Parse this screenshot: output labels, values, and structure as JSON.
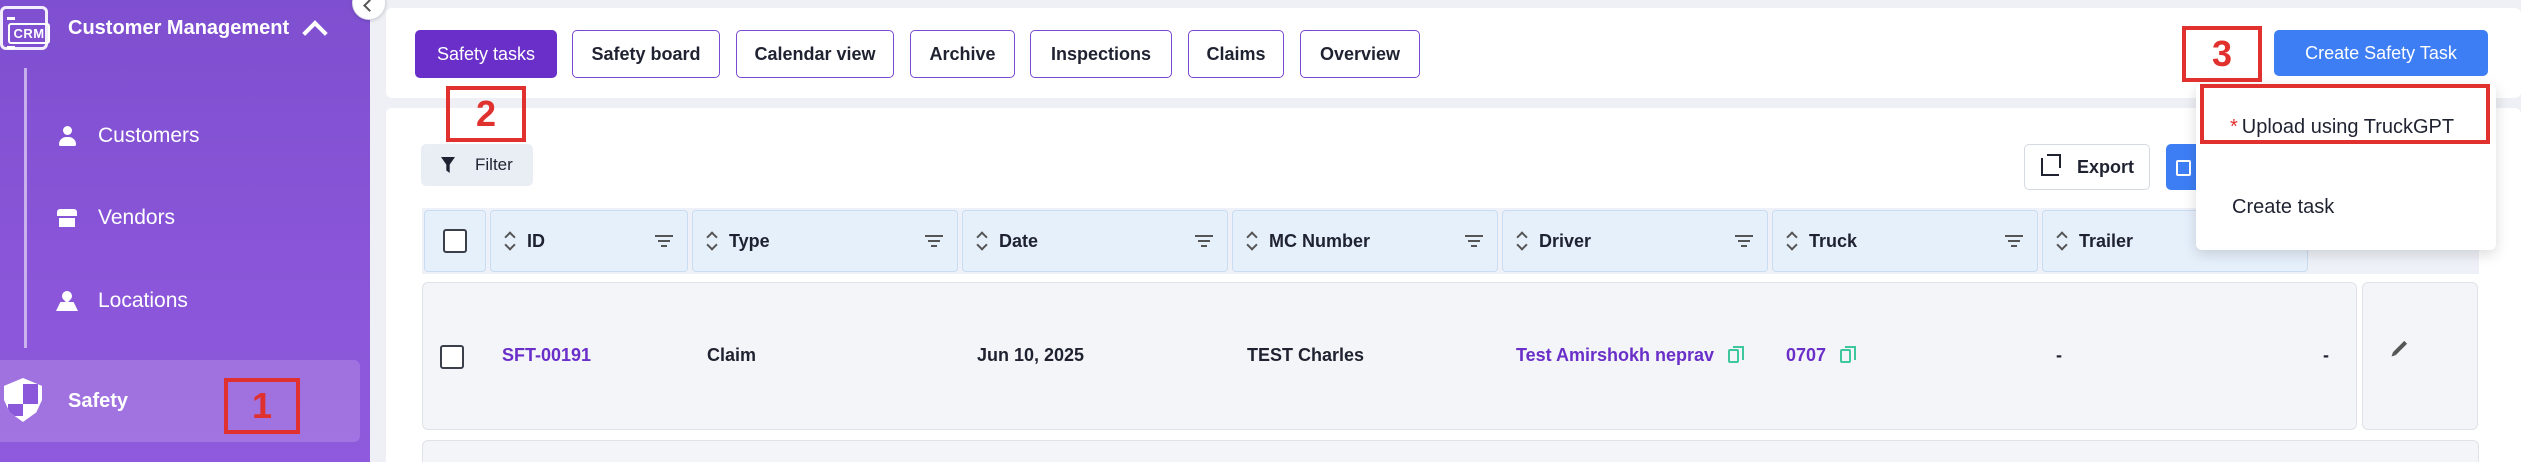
{
  "sidebar": {
    "logo_text": "CRM",
    "section_title": "Customer Management",
    "items": [
      {
        "label": "Customers"
      },
      {
        "label": "Vendors"
      },
      {
        "label": "Locations"
      }
    ],
    "active_item": {
      "label": "Safety"
    }
  },
  "annotations": [
    "1",
    "2",
    "3"
  ],
  "tabs": [
    {
      "label": "Safety tasks",
      "active": true
    },
    {
      "label": "Safety board"
    },
    {
      "label": "Calendar view"
    },
    {
      "label": "Archive"
    },
    {
      "label": "Inspections"
    },
    {
      "label": "Claims"
    },
    {
      "label": "Overview"
    }
  ],
  "toolbar": {
    "create_label": "Create Safety Task",
    "filter_label": "Filter",
    "export_label": "Export"
  },
  "dropdown": {
    "star": "*",
    "upload_label": "Upload using TruckGPT",
    "create_label": "Create task"
  },
  "table": {
    "columns": [
      "ID",
      "Type",
      "Date",
      "MC Number",
      "Driver",
      "Truck",
      "Trailer"
    ],
    "rows": [
      {
        "id": "SFT-00191",
        "type": "Claim",
        "date": "Jun 10, 2025",
        "mc_number": "TEST Charles",
        "driver": "Test Amirshokh neprav",
        "truck": "0707",
        "trailer": "-",
        "extra": "-"
      }
    ]
  },
  "colors": {
    "sidebar": "#8a55d8",
    "active_tab": "#6a2fc8",
    "primary_button": "#3d7ef5",
    "annotation": "#e0312f",
    "copy_icon": "#3ec79a"
  }
}
